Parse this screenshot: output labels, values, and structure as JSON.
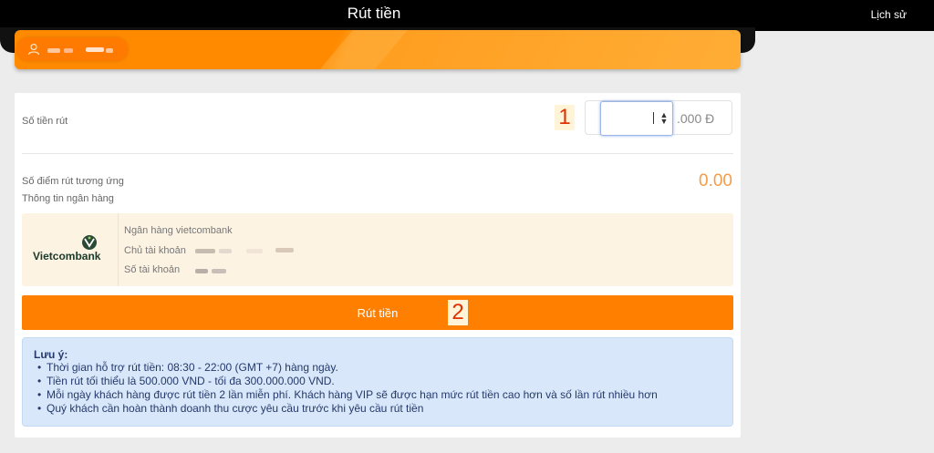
{
  "header": {
    "title": "Rút tiền",
    "history_link": "Lịch sử"
  },
  "user": {
    "icon": "user-icon"
  },
  "withdraw_form": {
    "amount_label": "Số tiền rút",
    "amount_value": "",
    "amount_unit": ".000 Đ",
    "marker_1": "1",
    "points_label": "Số điểm rút tương ứng",
    "points_value": "0.00",
    "bank_info_label": "Thông tin ngân hàng",
    "bank": {
      "logo_text": "Vietcombank",
      "bank_name": "Ngân hàng vietcombank",
      "account_holder_label": "Chủ tài khoản",
      "account_number_label": "Số tài khoản"
    },
    "submit_label": "Rút tiền",
    "marker_2": "2"
  },
  "notes": {
    "title": "Lưu ý:",
    "items": [
      "Thời gian hỗ trợ rút tiền: 08:30 - 22:00 (GMT +7) hàng ngày.",
      "Tiền rút tối thiểu là 500.000 VND - tối đa 300.000.000 VND.",
      "Mỗi ngày khách hàng được rút tiền 2 lần miễn phí. Khách hàng VIP sẽ được hạn mức rút tiền cao hơn và số lần rút nhiều hơn",
      "Quý khách cần hoàn thành doanh thu cược yêu cầu trước khi yêu cầu rút tiền"
    ]
  },
  "colors": {
    "accent_orange": "#ff7f00",
    "points_orange": "#f39c4a",
    "note_bg": "#d8e8fa",
    "bank_bg": "#fdf3e3"
  }
}
